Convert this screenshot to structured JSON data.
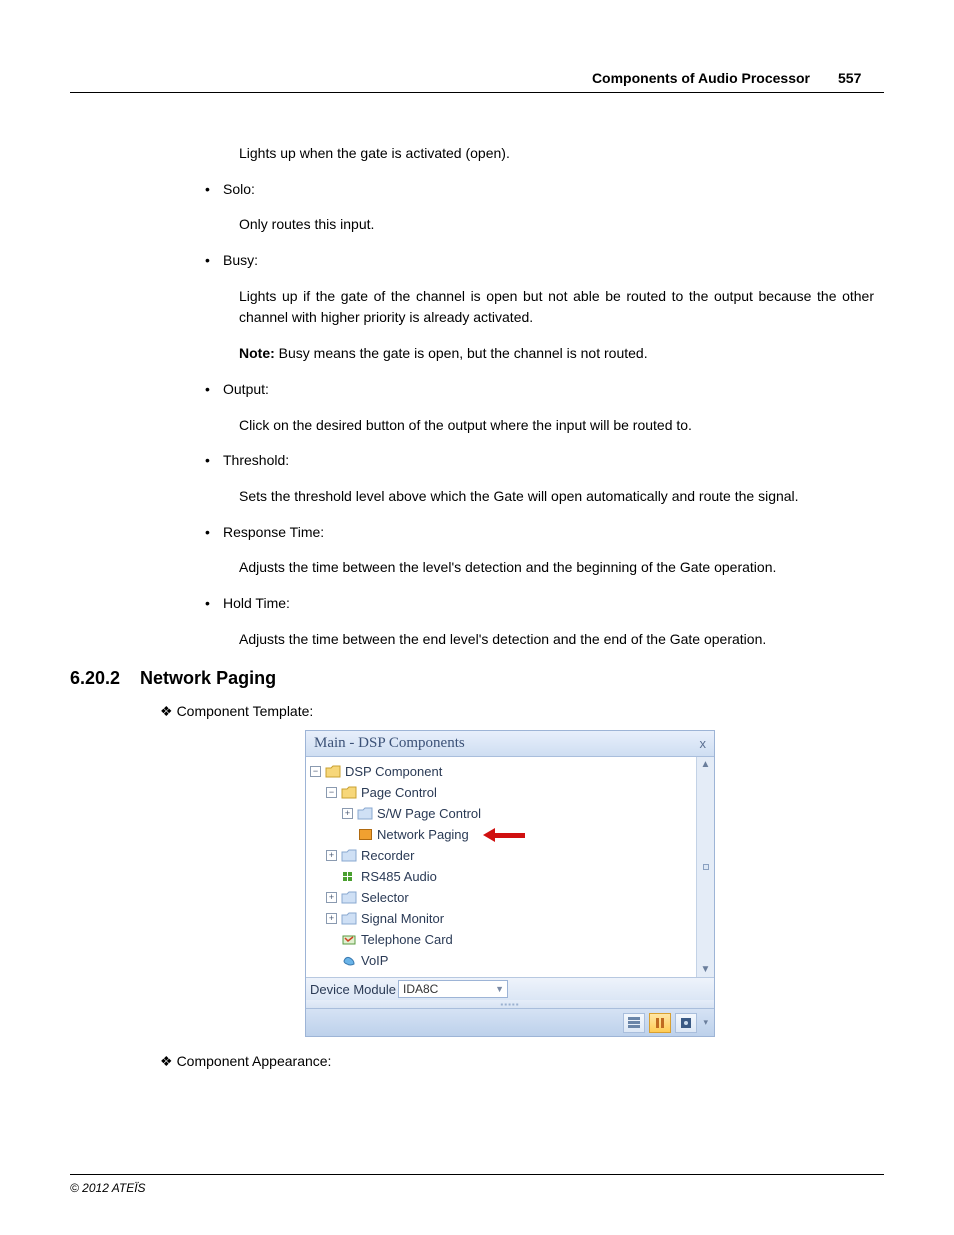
{
  "header": {
    "title": "Components of Audio Processor",
    "page_number": "557"
  },
  "body": {
    "gate_open_text": "Lights up when the gate is activated (open).",
    "solo": {
      "label": "Solo:",
      "text": "Only routes this input."
    },
    "busy": {
      "label": "Busy:",
      "text": "Lights up if the gate of the channel is open but not able be routed to the output because the other channel with higher priority is already activated.",
      "note_prefix": "Note:",
      "note_text": " Busy means the gate is open, but the channel is not routed."
    },
    "output": {
      "label": "Output:",
      "text": "Click on the desired button of the output where the input will be routed to."
    },
    "threshold": {
      "label": "Threshold:",
      "text": "Sets the threshold level above which the Gate will open automatically and route the signal."
    },
    "response": {
      "label": "Response Time:",
      "text": "Adjusts the time between the level's detection and the beginning of the Gate operation."
    },
    "hold": {
      "label": "Hold Time:",
      "text": "Adjusts the time between the end level's detection and the end of the Gate operation."
    }
  },
  "section": {
    "number": "6.20.2",
    "title": "Network Paging"
  },
  "template_label": "Component Template:",
  "appearance_label": "Component Appearance:",
  "panel": {
    "title": "Main - DSP Components",
    "tree": {
      "root": "DSP Component",
      "page_control": "Page Control",
      "sw_page_control": "S/W Page Control",
      "network_paging": "Network Paging",
      "recorder": "Recorder",
      "rs485": "RS485 Audio",
      "selector": "Selector",
      "signal_monitor": "Signal Monitor",
      "telephone_card": "Telephone Card",
      "voip": "VoIP"
    },
    "device_label": "Device Module",
    "device_value": "IDA8C"
  },
  "footer": "© 2012 ATEÏS"
}
